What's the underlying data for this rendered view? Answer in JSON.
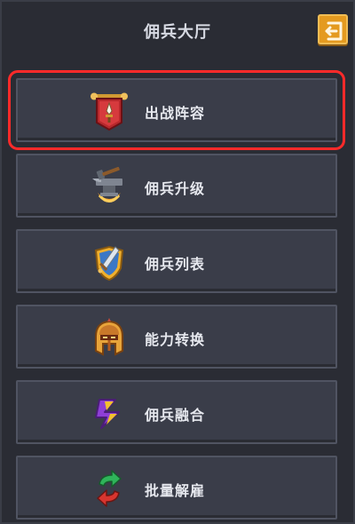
{
  "header": {
    "title": "佣兵大厅",
    "back_icon": "back-arrow-icon",
    "accent_color": "#e49a1f"
  },
  "menu": {
    "items": [
      {
        "label": "出战阵容",
        "icon": "banner-shield-icon",
        "selected": true
      },
      {
        "label": "佣兵升级",
        "icon": "anvil-icon",
        "selected": false
      },
      {
        "label": "佣兵列表",
        "icon": "sword-shield-icon",
        "selected": false
      },
      {
        "label": "能力转换",
        "icon": "helmet-icon",
        "selected": false
      },
      {
        "label": "佣兵融合",
        "icon": "fusion-icon",
        "selected": false
      },
      {
        "label": "批量解雇",
        "icon": "recycle-arrows-icon",
        "selected": false
      }
    ],
    "highlight_color": "#ff2a2a"
  }
}
